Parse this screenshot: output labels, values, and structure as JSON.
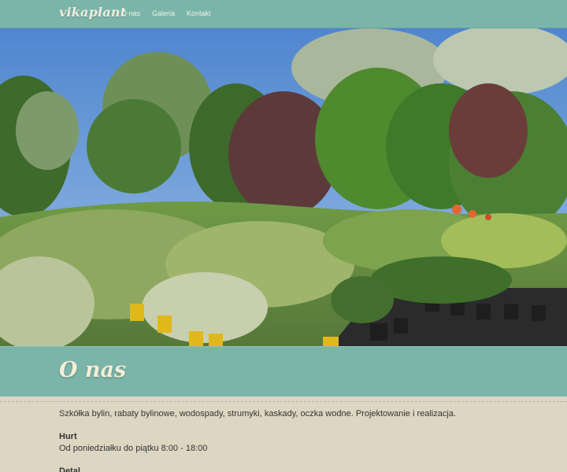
{
  "brand": {
    "logo": "vikaplant"
  },
  "nav": {
    "items": [
      "O nas",
      "Galeria",
      "Kontakt"
    ]
  },
  "hero": {
    "description": "garden nursery with potted perennials and trees"
  },
  "section": {
    "title": "O nas"
  },
  "content": {
    "intro": "Szkółka bylin, rabaty bylinowe, wodospady, strumyki, kaskady, oczka wodne. Projektowanie i realizacja.",
    "hurt_heading": "Hurt",
    "hurt_hours": "Od poniedziałku do piątku 8:00 - 18:00",
    "detal_heading": "Detal"
  },
  "colors": {
    "accent": "#7bb5aa",
    "background": "#ddd6c2",
    "title": "#f3eed6"
  }
}
